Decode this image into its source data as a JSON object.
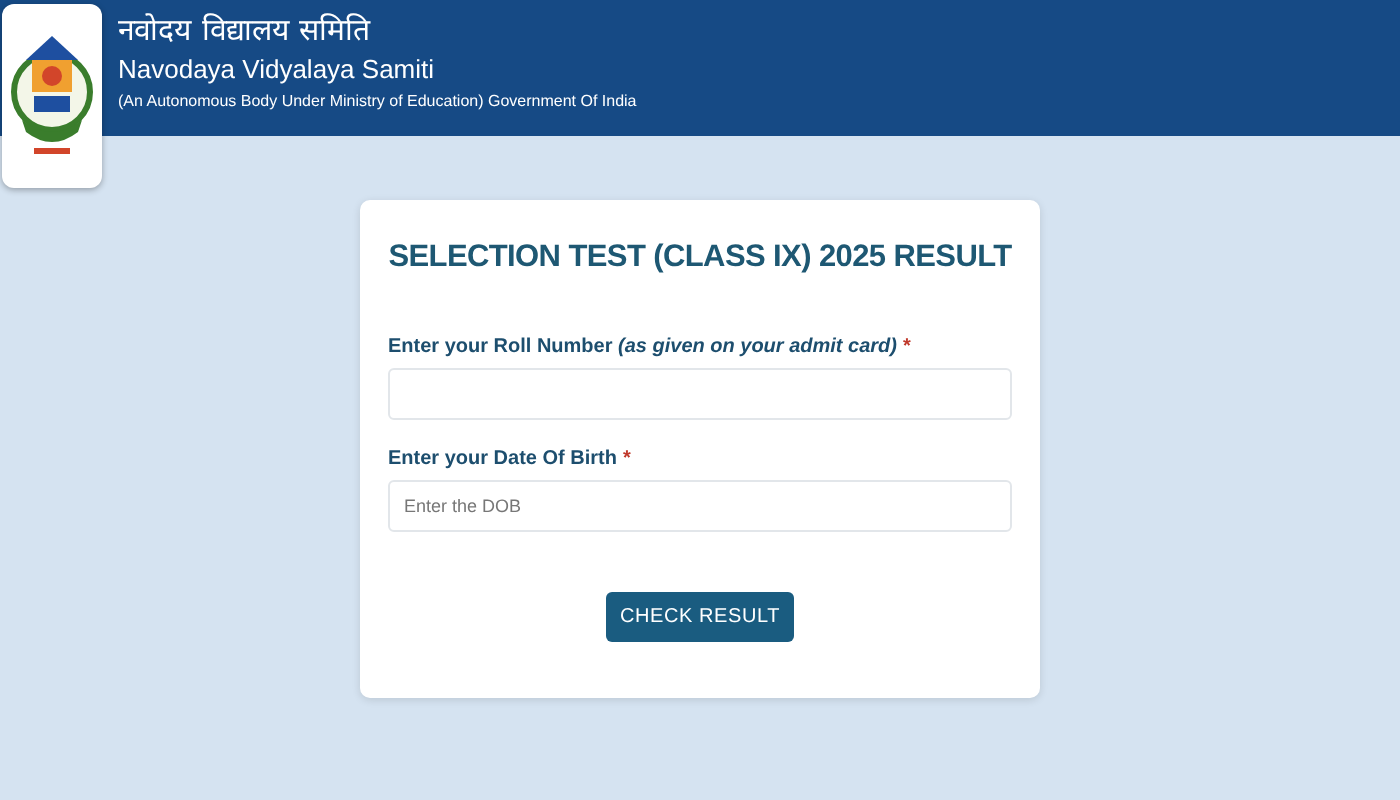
{
  "header": {
    "title_hindi": "नवोदय विद्यालय समिति",
    "title": "Navodaya Vidyalaya Samiti",
    "subtitle": "(An Autonomous Body Under Ministry of Education) Government Of India"
  },
  "form": {
    "heading": "SELECTION TEST (CLASS IX) 2025 RESULT",
    "fields": [
      {
        "label": "Enter your Roll Number *(as given on your admit card)*",
        "required_mark": "*"
      },
      {
        "label": "Enter your Date Of Birth",
        "required_mark": "*",
        "placeholder": "Enter the DOB"
      }
    ],
    "button": "CHECK RESULT"
  }
}
